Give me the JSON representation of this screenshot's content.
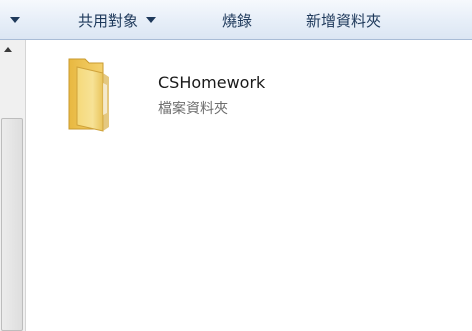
{
  "toolbar": {
    "share_with": "共用對象",
    "burn": "燒錄",
    "new_folder": "新增資料夾"
  },
  "files": [
    {
      "name": "CSHomework",
      "type": "檔案資料夾",
      "icon": "folder-icon"
    }
  ],
  "colors": {
    "toolbar_text": "#1e395b",
    "toolbar_bg": "#e6eef8",
    "folder_yellow": "#f2cf63",
    "type_text": "#6d6d6d"
  }
}
